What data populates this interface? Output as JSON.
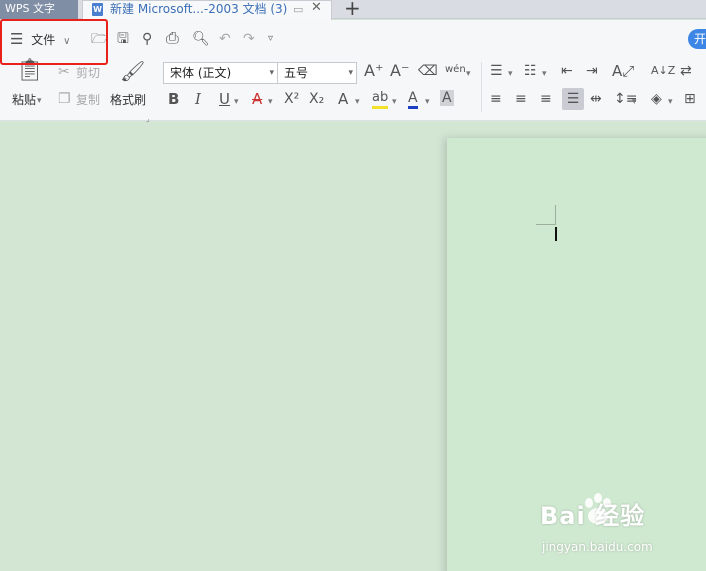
{
  "tabs": {
    "app_tab": "WPS 文字",
    "doc_icon_letter": "W",
    "doc_tab": "新建 Microsoft...-2003 文档 (3)",
    "new_tab": "+"
  },
  "toolbar": {
    "file_menu": "文件",
    "paste": "粘贴",
    "cut": "剪切",
    "copy": "复制",
    "format_painter": "格式刷",
    "font_name": "宋体 (正文)",
    "font_size": "五号",
    "phonetic": "wén",
    "bold": "B",
    "italic": "I",
    "underline": "U",
    "strike": "A",
    "sup": "X²",
    "sub": "X₂",
    "text_effect": "A",
    "highlight": "ab",
    "font_color": "A",
    "char_shade": "A",
    "sort": "A↓Z",
    "right_button": "开"
  },
  "watermark": {
    "brand": "Bai 经验",
    "site": "jingyan.baidu.com"
  },
  "colors": {
    "accent_red": "#e8221a",
    "highlight_yellow": "#f4e12a",
    "font_color_blue": "#1d3fc4",
    "blue_pill": "#3d86e6"
  }
}
